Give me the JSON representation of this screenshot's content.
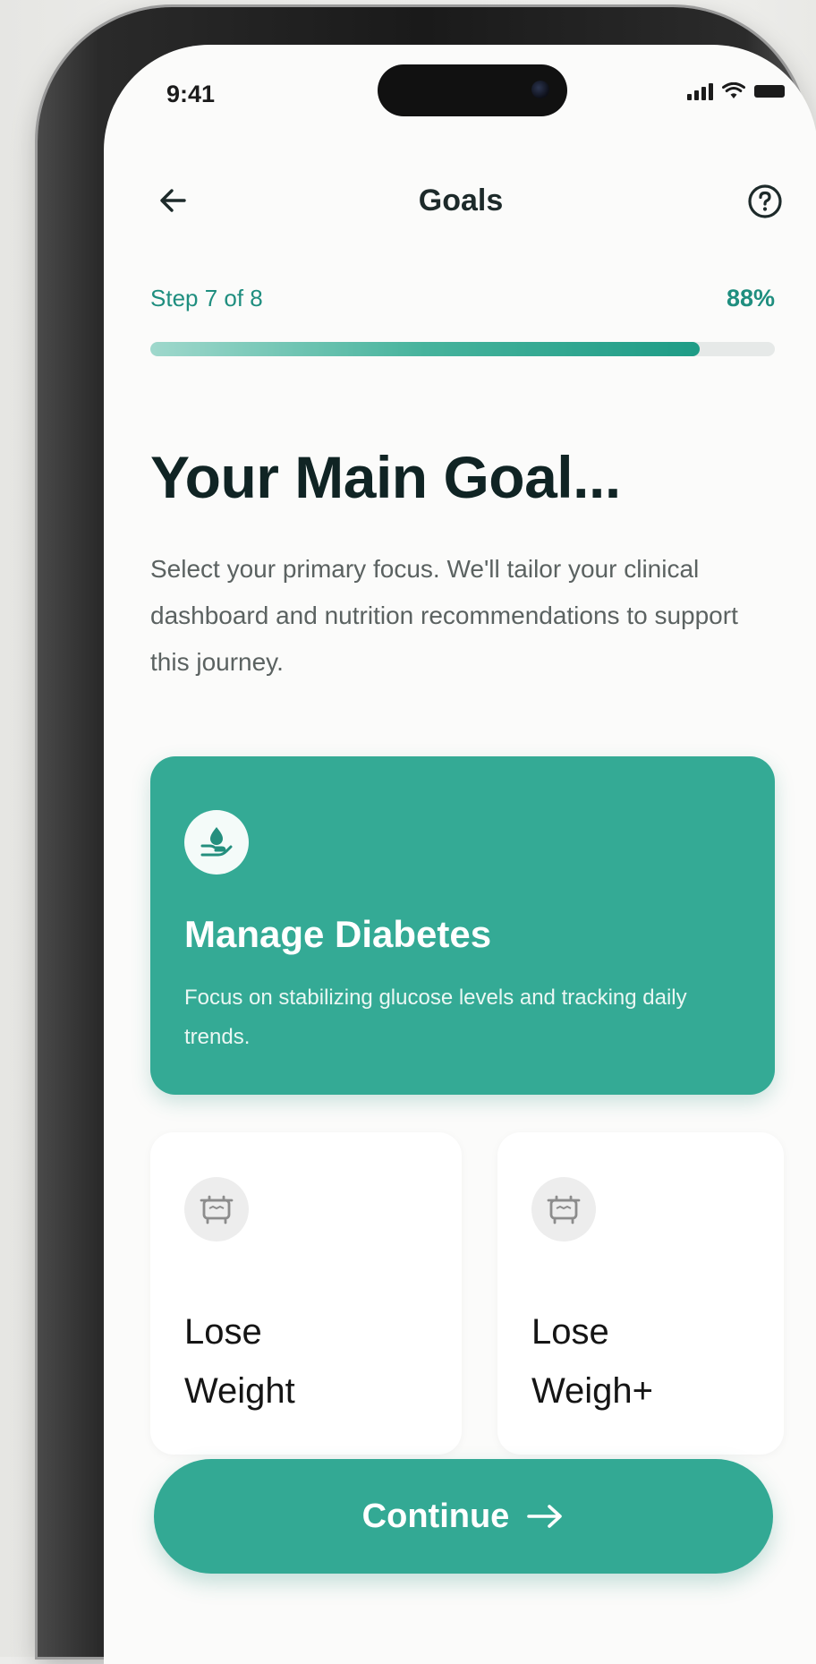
{
  "status_bar": {
    "time": "9:41"
  },
  "header": {
    "title": "Goals",
    "back_icon": "arrow-left-icon",
    "help_icon": "question-circle-icon"
  },
  "progress": {
    "step_label": "Step 7 of 8",
    "percent_label": "88%",
    "percent_value": 0.88
  },
  "main": {
    "heading": "Your Main Goal...",
    "intro": "Select your primary focus. We'll tailor your clinical dashboard and nutrition recommendations to support this journey."
  },
  "goals": [
    {
      "title": "Manage Diabetes",
      "description": "Focus on stabilizing glucose levels and tracking daily trends.",
      "icon": "drop-hand-icon",
      "selected": true
    },
    {
      "title": "Lose Weight",
      "icon": "scale-icon",
      "selected": false
    },
    {
      "title": "Lose Weigh+",
      "icon": "scale-icon",
      "selected": false
    }
  ],
  "footer": {
    "continue_label": "Continue",
    "continue_icon": "arrow-right-icon"
  },
  "colors": {
    "accent": "#34aa95",
    "accent_text": "#1f8e7f",
    "heading": "#102424",
    "body_text": "#5b6261"
  }
}
